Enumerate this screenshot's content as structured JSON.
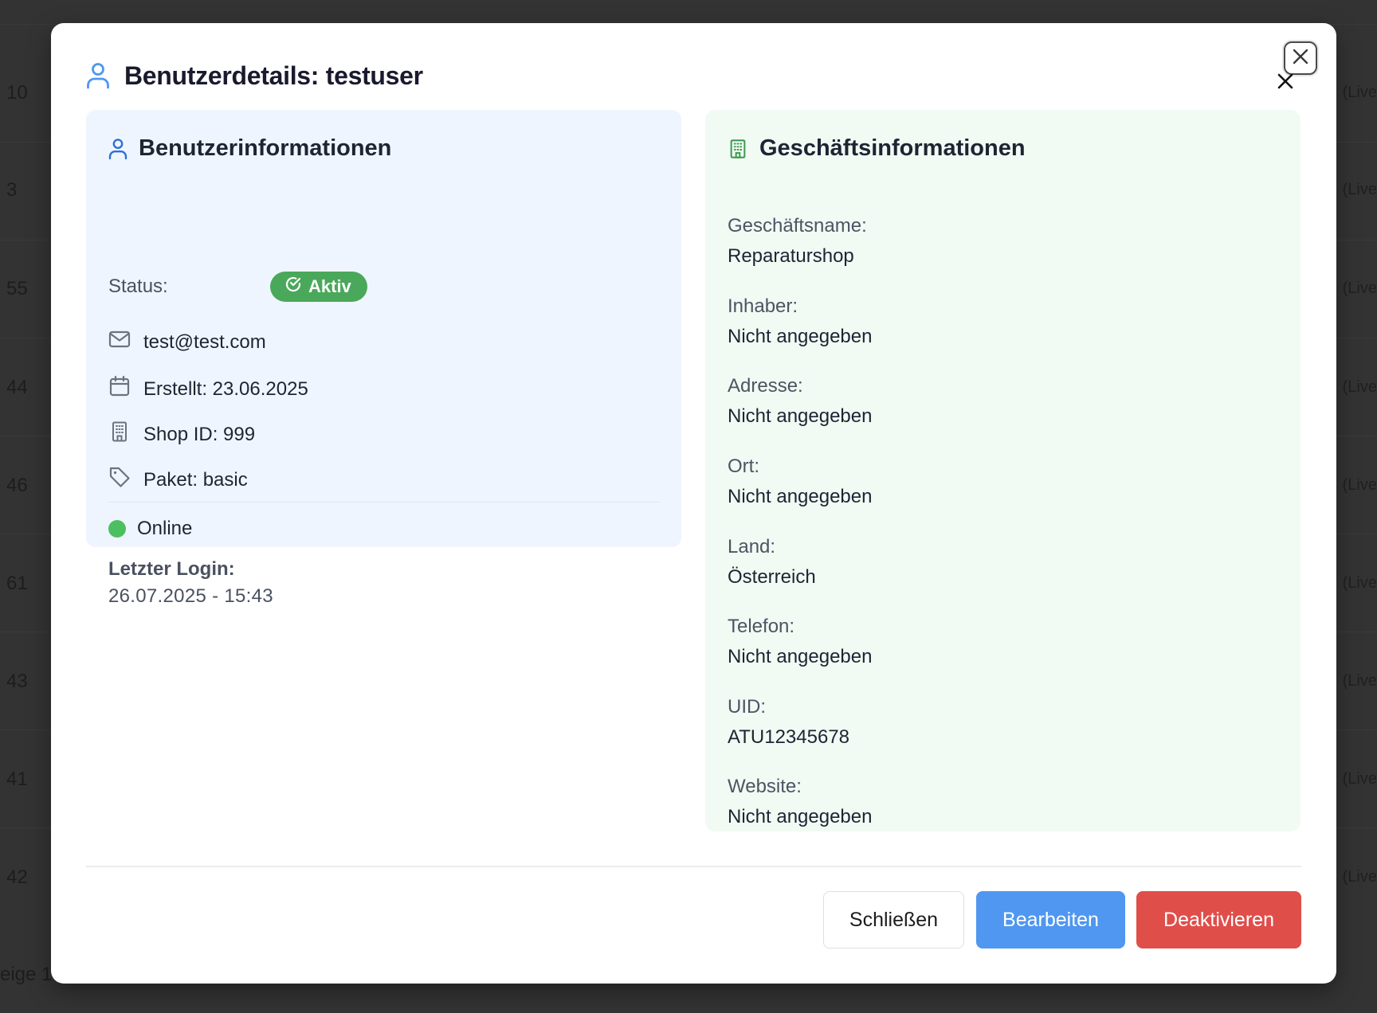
{
  "background": {
    "rows": [
      {
        "num": "10",
        "live": "(Live"
      },
      {
        "num": "3",
        "live": "(Live"
      },
      {
        "num": "55",
        "live": "(Live"
      },
      {
        "num": "44",
        "live": "(Live"
      },
      {
        "num": "46",
        "live": "(Live"
      },
      {
        "num": "61",
        "live": "(Live"
      },
      {
        "num": "43",
        "live": "(Live"
      },
      {
        "num": "41",
        "live": "(Live"
      },
      {
        "num": "42",
        "live": "(Live"
      }
    ],
    "footer_text": "eige 1"
  },
  "modal": {
    "title": "Benutzerdetails: testuser",
    "user_card": {
      "title": "Benutzerinformationen",
      "status_label": "Status:",
      "status_badge": "Aktiv",
      "email": "test@test.com",
      "created": "Erstellt: 23.06.2025",
      "shop_id": "Shop ID: 999",
      "package": "Paket: basic",
      "online_status": "Online",
      "last_login_label": "Letzter Login:",
      "last_login_value": "26.07.2025 - 15:43"
    },
    "business_card": {
      "title": "Geschäftsinformationen",
      "fields": [
        {
          "label": "Geschäftsname:",
          "value": "Reparaturshop"
        },
        {
          "label": "Inhaber:",
          "value": "Nicht angegeben"
        },
        {
          "label": "Adresse:",
          "value": "Nicht angegeben"
        },
        {
          "label": "Ort:",
          "value": "Nicht angegeben"
        },
        {
          "label": "Land:",
          "value": "Österreich"
        },
        {
          "label": "Telefon:",
          "value": "Nicht angegeben"
        },
        {
          "label": "UID:",
          "value": "ATU12345678"
        },
        {
          "label": "Website:",
          "value": "Nicht angegeben"
        }
      ]
    },
    "footer": {
      "close_label": "Schließen",
      "edit_label": "Bearbeiten",
      "deactivate_label": "Deaktivieren"
    }
  },
  "colors": {
    "accent_blue": "#4f97f0",
    "danger_red": "#e04e4a",
    "success_green": "#4aa85a",
    "online_green": "#4cbf60",
    "user_card_bg": "#eff5fe",
    "business_card_bg": "#f1fbf4"
  },
  "icons": {
    "title": "user-icon",
    "user_card": "user-icon",
    "business_card": "building-icon",
    "email": "mail-icon",
    "created": "calendar-icon",
    "shop": "building-icon",
    "package": "tag-icon",
    "badge": "check-circle-icon",
    "close": "close-icon"
  }
}
